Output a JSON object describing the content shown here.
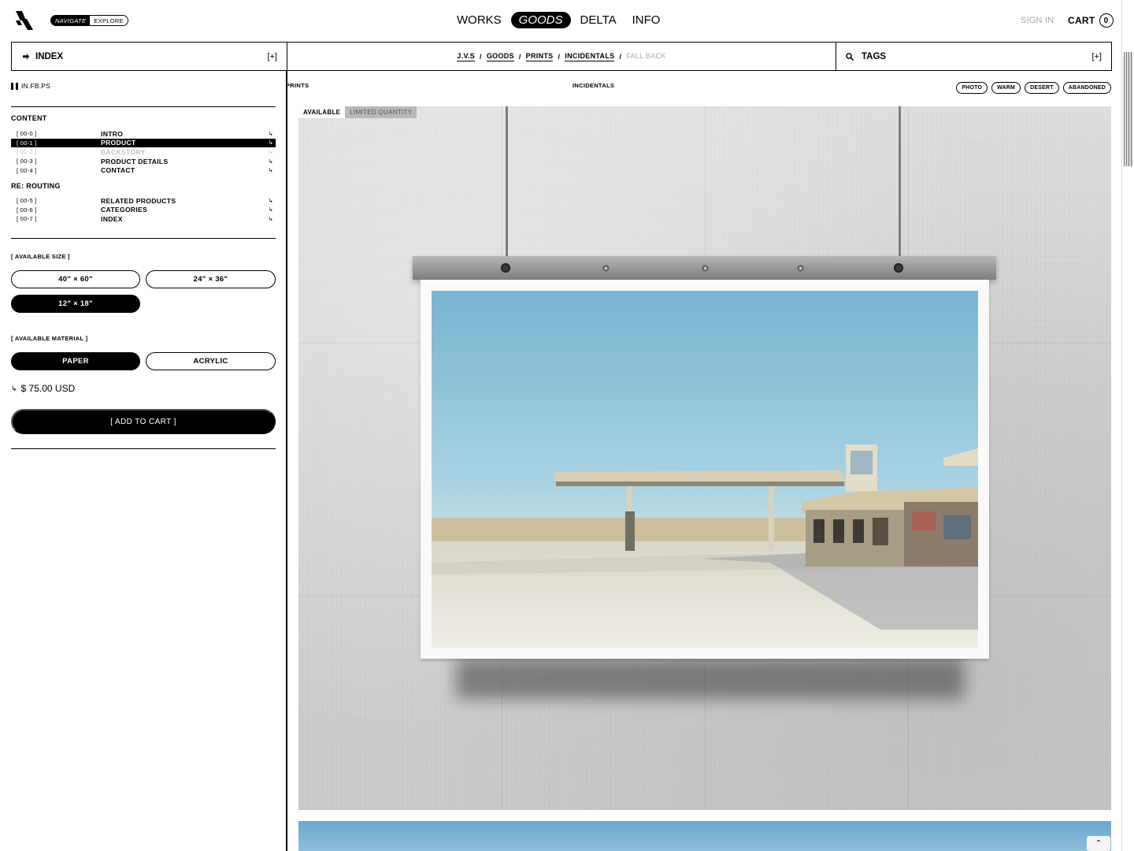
{
  "header": {
    "mode_on": "NAVIGATE",
    "mode_off": "EXPLORE",
    "nav": [
      "WORKS",
      "GOODS",
      "DELTA",
      "INFO"
    ],
    "active_nav": "GOODS",
    "signin": "SIGN IN",
    "cart_label": "CART",
    "cart_count": "0"
  },
  "cmdbar": {
    "index_label": "INDEX",
    "index_plus": "[+]",
    "breadcrumbs": [
      "J.V.S",
      "GOODS",
      "PRINTS",
      "INCIDENTALS"
    ],
    "breadcrumb_sep": "/",
    "current": "FALL BACK",
    "tags_label": "TAGS",
    "tags_plus": "[+]"
  },
  "sidebar": {
    "system_id": "IN.FB.PS",
    "content_title": "CONTENT",
    "content_items": [
      {
        "num": "[ 00-0 ]",
        "label": "INTRO",
        "arrow": "↳"
      },
      {
        "num": "[ 00-1 ]",
        "label": "PRODUCT",
        "arrow": "↳"
      },
      {
        "num": "[ 00-2 ]",
        "label": "BACKSTORY",
        "arrow": "↳"
      },
      {
        "num": "[ 00-3 ]",
        "label": "PRODUCT DETAILS",
        "arrow": "↳"
      },
      {
        "num": "[ 00-4 ]",
        "label": "CONTACT",
        "arrow": "↳"
      }
    ],
    "routing_title": "RE: ROUTING",
    "routing_items": [
      {
        "num": "[ 00-5 ]",
        "label": "RELATED PRODUCTS",
        "arrow": "↳"
      },
      {
        "num": "[ 00-6 ]",
        "label": "CATEGORIES",
        "arrow": "↳"
      },
      {
        "num": "[ 00-7 ]",
        "label": "INDEX",
        "arrow": "↳"
      }
    ],
    "size_label": "[ AVAILABLE SIZE ]",
    "sizes": [
      "40\" × 60\"",
      "24\" × 36\"",
      "12\" × 18\""
    ],
    "selected_size": "12\" × 18\"",
    "material_label": "[ AVAILABLE MATERIAL ]",
    "materials": [
      "PAPER",
      "ACRYLIC"
    ],
    "selected_material": "PAPER",
    "price_arrow": "↳",
    "price": "$ 75.00 USD",
    "add_to_cart": "[ ADD TO CART ]"
  },
  "content": {
    "category_left": "PRINTS",
    "category_center": "INCIDENTALS",
    "tags": [
      "PHOTO",
      "WARM",
      "DESERT",
      "ABANDONED"
    ],
    "availability": "AVAILABLE",
    "quantity_note": "LIMITED QUANTITY"
  },
  "colors": {
    "accent": "#000000",
    "muted": "#aaaaaa",
    "sky": "#8fc3dd",
    "wall": "#d4d4d4"
  },
  "icons": {
    "logo": "logo-mark-icon",
    "index": "index-arrow-icon",
    "search": "search-icon",
    "scroll_top": "chevron-up-icon"
  }
}
